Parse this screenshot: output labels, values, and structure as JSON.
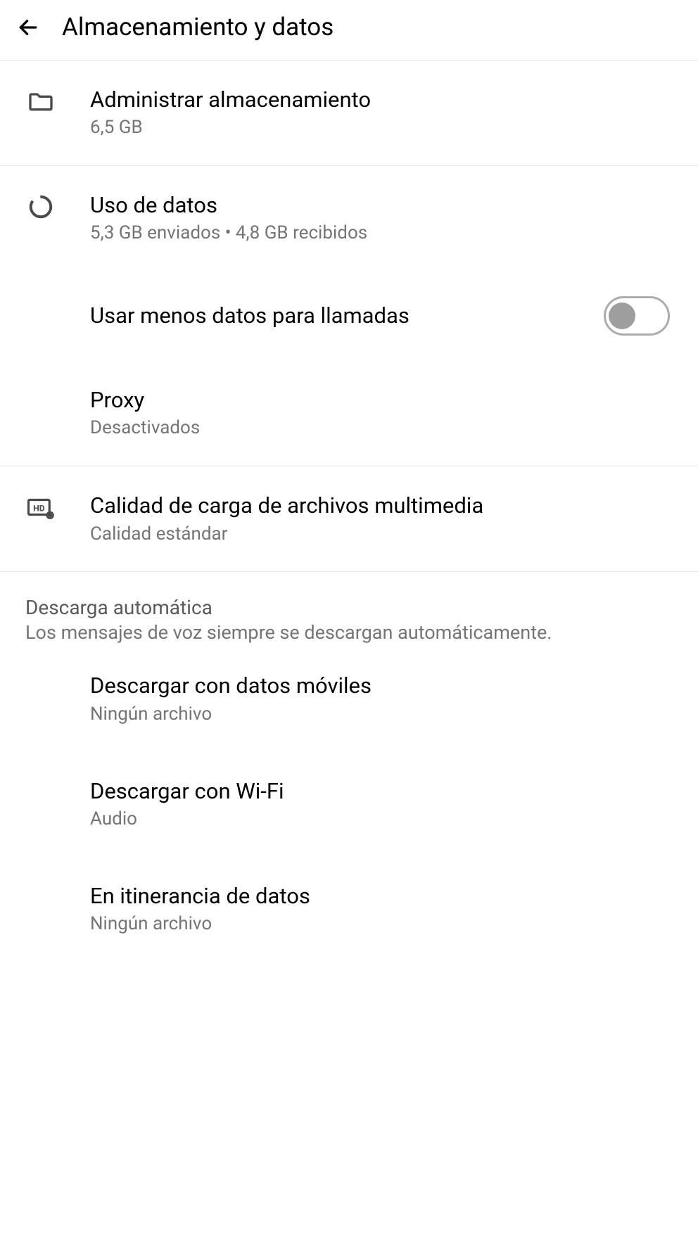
{
  "header": {
    "title": "Almacenamiento y datos"
  },
  "storage": {
    "title": "Administrar almacenamiento",
    "subtitle": "6,5 GB"
  },
  "dataUsage": {
    "title": "Uso de datos",
    "subtitle": "5,3 GB enviados • 4,8 GB recibidos"
  },
  "lessData": {
    "title": "Usar menos datos para llamadas"
  },
  "proxy": {
    "title": "Proxy",
    "subtitle": "Desactivados"
  },
  "mediaQuality": {
    "title": "Calidad de carga de archivos multimedia",
    "subtitle": "Calidad estándar"
  },
  "autoDownload": {
    "sectionTitle": "Descarga automática",
    "sectionDescription": "Los mensajes de voz siempre se descargan automáticamente."
  },
  "mobileData": {
    "title": "Descargar con datos móviles",
    "subtitle": "Ningún archivo"
  },
  "wifi": {
    "title": "Descargar con Wi-Fi",
    "subtitle": "Audio"
  },
  "roaming": {
    "title": "En itinerancia de datos",
    "subtitle": "Ningún archivo"
  }
}
